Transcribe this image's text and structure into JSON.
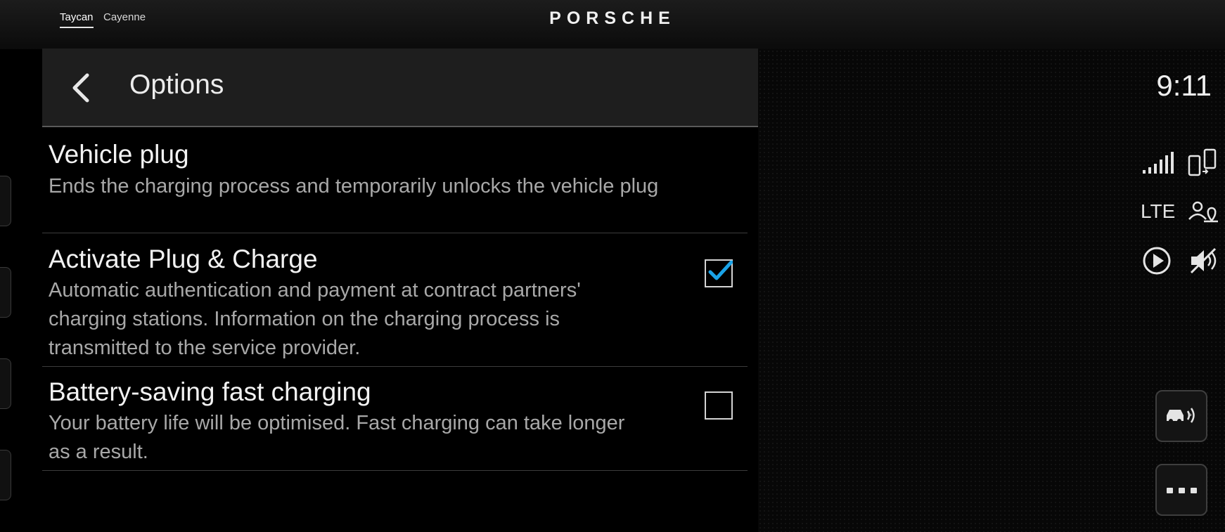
{
  "top_bar": {
    "model_tabs": [
      {
        "label": "Taycan",
        "active": true
      },
      {
        "label": "Cayenne",
        "active": false
      }
    ],
    "brand_logo": "PORSCHE"
  },
  "panel": {
    "back_icon": "chevron-left-icon",
    "title": "Options"
  },
  "options": [
    {
      "title": "Vehicle plug",
      "description": "Ends the charging process and temporarily unlocks the vehicle plug",
      "has_checkbox": false
    },
    {
      "title": "Activate Plug & Charge",
      "description": "Automatic authentication and payment at contract partners' charging stations. Information on the charging process is transmitted to the service provider.",
      "has_checkbox": true,
      "checked": true
    },
    {
      "title": "Battery-saving fast charging",
      "description": "Your battery life will be optimised. Fast charging can take longer as a result.",
      "has_checkbox": true,
      "checked": false
    }
  ],
  "status": {
    "time": "9:11",
    "network": "LTE",
    "icons": [
      "signal-strength-icon",
      "phone-connection-icon",
      "location-sharing-icon",
      "media-play-icon",
      "sound-muted-icon"
    ]
  },
  "side_buttons": {
    "car_sensor_icon": "car-parking-sensor-icon",
    "more_icon": "more-dots-icon"
  },
  "colors": {
    "accent": "#1aa3e8",
    "panel_header_bg": "#1e1e1e",
    "divider": "#3c3c3c",
    "background": "#000000"
  }
}
